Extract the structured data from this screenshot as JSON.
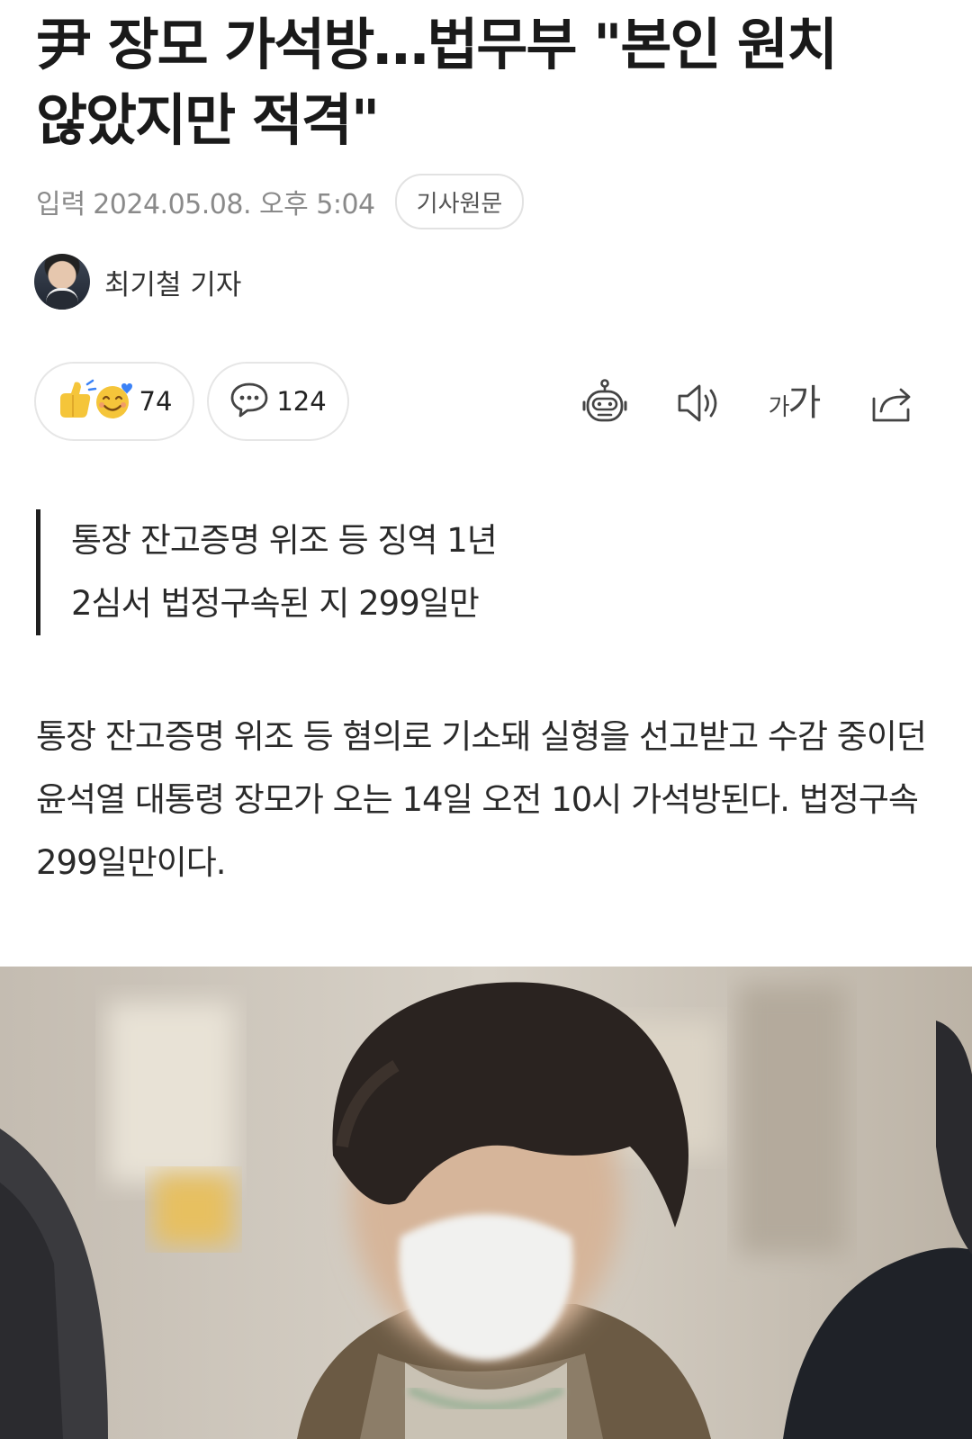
{
  "headline": "尹 장모 가석방…법무부 \"본인 원치 않았지만 적격\"",
  "meta": {
    "date_label": "입력",
    "date_value": "2024.05.08. 오후 5:04",
    "original_button": "기사원문"
  },
  "byline": {
    "reporter": "최기철 기자"
  },
  "actions": {
    "reaction_count": "74",
    "comment_count": "124"
  },
  "summary": [
    "통장 잔고증명 위조 등 징역 1년",
    "2심서 법정구속된 지 299일만"
  ],
  "body": "통장 잔고증명 위조 등 혐의로 기소돼 실형을 선고받고 수감 중이던 윤석열 대통령 장모가 오는 14일 오전 10시 가석방된다. 법정구속 299일만이다.",
  "icons": {
    "reaction": "reaction-emoji-icon",
    "comment": "comment-bubble-icon",
    "summary_bot": "robot-icon",
    "listen": "speaker-icon",
    "font_size": "font-size-icon",
    "share": "share-icon"
  },
  "colors": {
    "text": "#1a1a1a",
    "muted": "#8a8a8a",
    "border": "#e6e6e6",
    "emoji": "#f5c53a",
    "heart": "#3b82f6"
  }
}
